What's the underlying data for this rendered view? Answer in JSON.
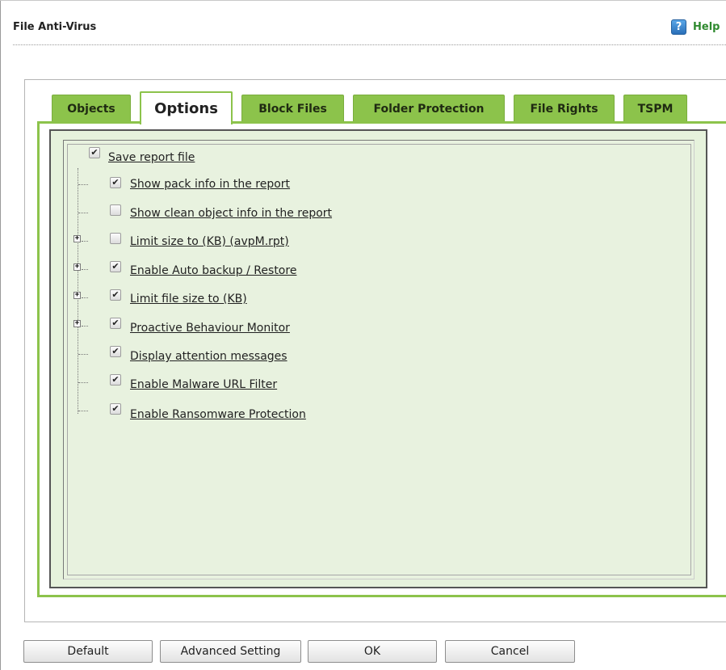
{
  "window": {
    "title": "File Anti-Virus",
    "help_label": "Help",
    "help_icon": "help-icon"
  },
  "tabs": [
    {
      "label": "Objects",
      "active": false
    },
    {
      "label": "Options",
      "active": true
    },
    {
      "label": "Block Files",
      "active": false
    },
    {
      "label": "Folder Protection",
      "active": false
    },
    {
      "label": "File Rights",
      "active": false
    },
    {
      "label": "TSPM",
      "active": false
    }
  ],
  "options": {
    "root": {
      "label": "Save report file",
      "checked": true
    },
    "items": [
      {
        "label": "Show pack info in the report",
        "checked": true,
        "expandable": false
      },
      {
        "label": "Show clean object info in the report",
        "checked": false,
        "expandable": false
      },
      {
        "label": "Limit size to (KB) (avpM.rpt)",
        "checked": false,
        "expandable": true
      },
      {
        "label": "Enable Auto backup / Restore",
        "checked": true,
        "expandable": true
      },
      {
        "label": "Limit file size to (KB)",
        "checked": true,
        "expandable": true
      },
      {
        "label": "Proactive Behaviour Monitor",
        "checked": true,
        "expandable": true
      },
      {
        "label": "Display attention messages",
        "checked": true,
        "expandable": false
      },
      {
        "label": "Enable Malware URL Filter",
        "checked": true,
        "expandable": false
      },
      {
        "label": "Enable Ransomware Protection",
        "checked": true,
        "expandable": false
      }
    ]
  },
  "buttons": {
    "default": "Default",
    "advanced": "Advanced Setting",
    "ok": "OK",
    "cancel": "Cancel"
  },
  "colors": {
    "tab_green": "#8cc34b",
    "panel_bg": "#e8f2df",
    "help_green": "#2f8a2f"
  }
}
